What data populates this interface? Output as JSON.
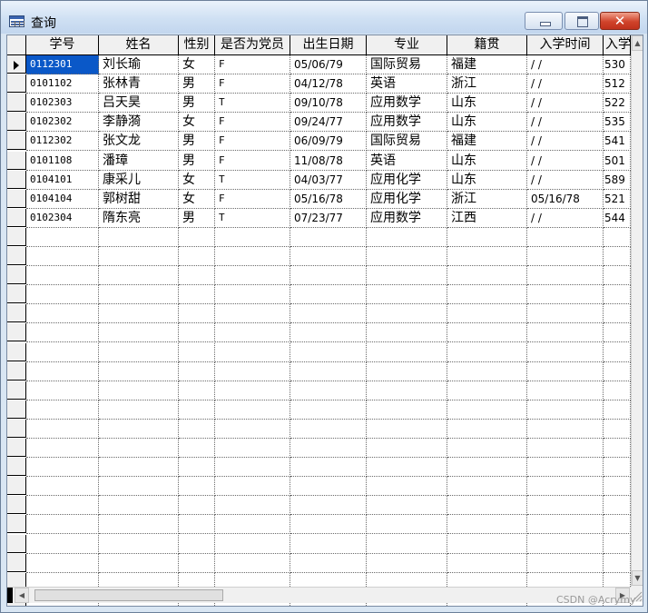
{
  "window": {
    "title": "查询",
    "minimize_label": "minimize",
    "maximize_label": "restore",
    "close_glyph": "✕"
  },
  "grid": {
    "columns": [
      "学号",
      "姓名",
      "性别",
      "是否为党员",
      "出生日期",
      "专业",
      "籍贯",
      "入学时间",
      "入学"
    ],
    "rows": [
      [
        "0112301",
        "刘长瑜",
        "女",
        "F",
        "05/06/79",
        "国际贸易",
        "福建",
        "/  /",
        "530"
      ],
      [
        "0101102",
        "张林青",
        "男",
        "F",
        "04/12/78",
        "英语",
        "浙江",
        "/  /",
        "512"
      ],
      [
        "0102303",
        "吕天昊",
        "男",
        "T",
        "09/10/78",
        "应用数学",
        "山东",
        "/  /",
        "522"
      ],
      [
        "0102302",
        "李静漪",
        "女",
        "F",
        "09/24/77",
        "应用数学",
        "山东",
        "/  /",
        "535"
      ],
      [
        "0112302",
        "张文龙",
        "男",
        "F",
        "06/09/79",
        "国际贸易",
        "福建",
        "/  /",
        "541"
      ],
      [
        "0101108",
        "潘璋",
        "男",
        "F",
        "11/08/78",
        "英语",
        "山东",
        "/  /",
        "501"
      ],
      [
        "0104101",
        "康采儿",
        "女",
        "T",
        "04/03/77",
        "应用化学",
        "山东",
        "/  /",
        "589"
      ],
      [
        "0104104",
        "郭树甜",
        "女",
        "F",
        "05/16/78",
        "应用化学",
        "浙江",
        "05/16/78",
        "521"
      ],
      [
        "0102304",
        "隋东亮",
        "男",
        "T",
        "07/23/77",
        "应用数学",
        "江西",
        "/  /",
        "544"
      ]
    ],
    "selected_row": 0,
    "selected_col": 0
  },
  "watermark": "CSDN @Acrymy",
  "icons": {
    "app": "table-window-icon",
    "row_pointer": "current-row-pointer-icon",
    "scroll_up": "arrow-up-icon",
    "scroll_down": "arrow-down-icon",
    "scroll_left": "arrow-left-icon",
    "scroll_right": "arrow-right-icon"
  },
  "colors": {
    "selection": "#0a58c8",
    "title_gradient_top": "#eaf2fb",
    "close_button": "#d0432b"
  }
}
